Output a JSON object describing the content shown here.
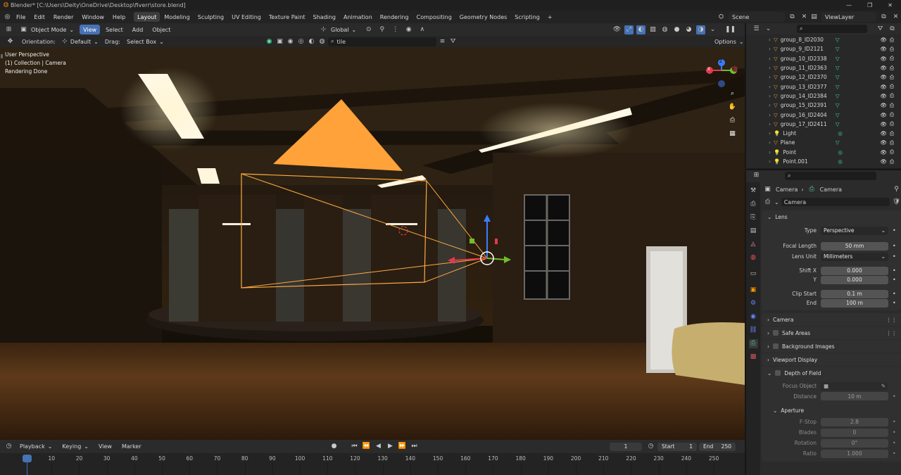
{
  "window": {
    "title": "Blender* [C:\\Users\\Deity\\OneDrive\\Desktop\\fiverr\\store.blend]",
    "controls": [
      "—",
      "❐",
      "✕"
    ]
  },
  "menubar": {
    "items": [
      "File",
      "Edit",
      "Render",
      "Window",
      "Help"
    ]
  },
  "workspaces": {
    "tabs": [
      "Layout",
      "Modeling",
      "Sculpting",
      "UV Editing",
      "Texture Paint",
      "Shading",
      "Animation",
      "Rendering",
      "Compositing",
      "Geometry Nodes",
      "Scripting"
    ],
    "active": "Layout",
    "add": "+"
  },
  "scene": {
    "name": "Scene",
    "view_layer": "ViewLayer"
  },
  "viewport_header": {
    "mode": "Object Mode",
    "menus": [
      "View",
      "Select",
      "Add",
      "Object"
    ],
    "transform": "Global"
  },
  "tool_header": {
    "orientation_label": "Orientation:",
    "orientation_value": "Default",
    "drag_label": "Drag:",
    "drag_value": "Select Box",
    "search_value": "tile",
    "options": "Options"
  },
  "viewport_info": {
    "line1": "User Perspective",
    "line2": "(1) Collection | Camera",
    "line3": "Rendering Done"
  },
  "gizmo": {
    "x": "X",
    "y": "Y",
    "z": "Z"
  },
  "outliner": {
    "items": [
      "group_8_ID2030",
      "group_9_ID2121",
      "group_10_ID2338",
      "group_11_ID2363",
      "group_12_ID2370",
      "group_13_ID2377",
      "group_14_ID2384",
      "group_15_ID2391",
      "group_16_ID2404",
      "group_17_ID2411",
      "Light",
      "Plane",
      "Point",
      "Point.001"
    ]
  },
  "properties": {
    "breadcrumb": {
      "object": "Camera",
      "data": "Camera"
    },
    "datablock": "Camera",
    "lens": {
      "title": "Lens",
      "type_label": "Type",
      "type_value": "Perspective",
      "focal_label": "Focal Length",
      "focal_value": "50 mm",
      "unit_label": "Lens Unit",
      "unit_value": "Millimeters",
      "shiftx_label": "Shift X",
      "shiftx_value": "0.000",
      "y_label": "Y",
      "y_value": "0.000",
      "clipstart_label": "Clip Start",
      "clipstart_value": "0.1 m",
      "end_label": "End",
      "end_value": "100 m"
    },
    "sections": [
      "Camera",
      "Safe Areas",
      "Background Images",
      "Viewport Display",
      "Depth of Field"
    ],
    "dof": {
      "focus_label": "Focus Object",
      "distance_label": "Distance",
      "distance_value": "10 m",
      "aperture": "Aperture",
      "fstop_label": "F-Stop",
      "fstop_value": "2.8",
      "blades_label": "Blades",
      "blades_value": "0",
      "rotation_label": "Rotation",
      "rotation_value": "0°",
      "ratio_label": "Ratio",
      "ratio_value": "1.000"
    }
  },
  "timeline": {
    "menus": [
      "Playback",
      "Keying",
      "View",
      "Marker"
    ],
    "current_frame": "1",
    "start_label": "Start",
    "start_value": "1",
    "end_label": "End",
    "end_value": "250",
    "ticks": [
      "1",
      "10",
      "20",
      "30",
      "40",
      "50",
      "60",
      "70",
      "80",
      "90",
      "100",
      "110",
      "120",
      "130",
      "140",
      "150",
      "160",
      "170",
      "180",
      "190",
      "200",
      "210",
      "220",
      "230",
      "240",
      "250"
    ]
  },
  "colors": {
    "accent": "#4772b3",
    "camera_select": "#ffaa40",
    "bg": "#1d1d1d",
    "panel": "#303030"
  }
}
